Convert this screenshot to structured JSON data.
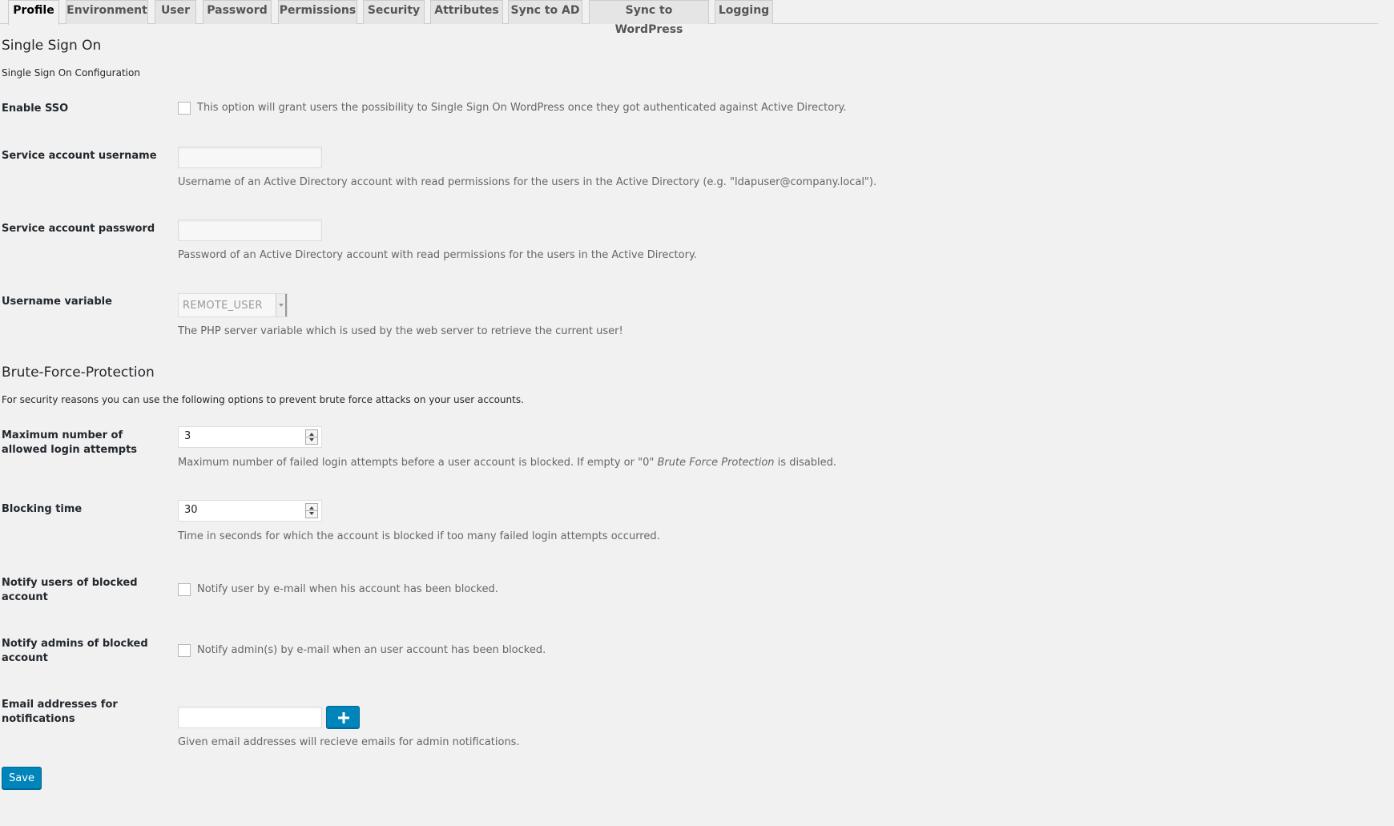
{
  "tabs": [
    {
      "label": "Profile",
      "active": true
    },
    {
      "label": "Environment"
    },
    {
      "label": "User"
    },
    {
      "label": "Password"
    },
    {
      "label": "Permissions"
    },
    {
      "label": "Security"
    },
    {
      "label": "Attributes"
    },
    {
      "label": "Sync to AD"
    },
    {
      "label": "Sync to WordPress"
    },
    {
      "label": "Logging"
    }
  ],
  "sso": {
    "title": "Single Sign On",
    "intro": "Single Sign On Configuration",
    "enable": {
      "label": "Enable SSO",
      "checked": false,
      "text": "This option will grant users the possibility to Single Sign On WordPress once they got authenticated against Active Directory."
    },
    "username": {
      "label": "Service account username",
      "value": "",
      "desc": "Username of an Active Directory account with read permissions for the users in the Active Directory (e.g. \"ldapuser@company.local\")."
    },
    "password": {
      "label": "Service account password",
      "value": "",
      "desc": "Password of an Active Directory account with read permissions for the users in the Active Directory."
    },
    "username_variable": {
      "label": "Username variable",
      "value": "REMOTE_USER",
      "desc": "The PHP server variable which is used by the web server to retrieve the current user!"
    }
  },
  "brute_force": {
    "title": "Brute-Force-Protection",
    "intro": "For security reasons you can use the following options to prevent brute force attacks on your user accounts.",
    "max_attempts": {
      "label": "Maximum number of allowed login attempts",
      "value": "3",
      "desc_before": "Maximum number of failed login attempts before a user account is blocked. If empty or \"0\" ",
      "desc_em": "Brute Force Protection",
      "desc_after": " is disabled."
    },
    "blocking_time": {
      "label": "Blocking time",
      "value": "30",
      "desc": "Time in seconds for which the account is blocked if too many failed login attempts occurred."
    },
    "notify_users": {
      "label": "Notify users of blocked account",
      "checked": false,
      "text": "Notify user by e-mail when his account has been blocked."
    },
    "notify_admins": {
      "label": "Notify admins of blocked account",
      "checked": false,
      "text": "Notify admin(s) by e-mail when an user account has been blocked."
    },
    "emails": {
      "label": "Email addresses for notifications",
      "value": "",
      "desc": "Given email addresses will recieve emails for admin notifications."
    }
  },
  "icons": {
    "add": "plus-icon"
  },
  "colors": {
    "primary_button": "#0085ba",
    "background": "#f1f1f1"
  },
  "save_label": "Save"
}
